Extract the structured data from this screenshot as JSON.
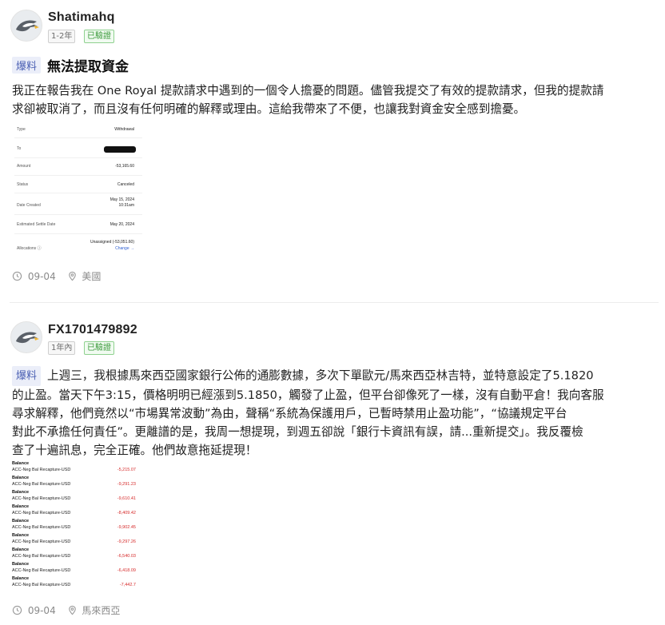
{
  "posts": [
    {
      "username": "Shatimahq",
      "tag_year": "1-2年",
      "tag_verified": "已驗證",
      "badge": "爆料",
      "title": "無法提取資金",
      "body_line1": "我正在報告我在 One Royal 提款請求中遇到的一個令人擔憂的問題。儘管我提交了有效的提款請求，但我的提款請",
      "body_line2": "求卻被取消了，而且沒有任何明確的解釋或理由。這給我帶來了不便，也讓我對資金安全感到擔憂。",
      "date": "09-04",
      "location": "美國",
      "screenshot": {
        "rows": [
          {
            "key": "Type",
            "value": "Withdrawal"
          },
          {
            "key": "To",
            "value": ""
          },
          {
            "key": "Amount",
            "value": "-53,165.60"
          },
          {
            "key": "Status",
            "value": "Canceled"
          },
          {
            "key": "Date Created",
            "value": "May 15, 2024",
            "value2": "10:31am"
          },
          {
            "key": "Estimated Settle Date",
            "value": "May 20, 2024"
          },
          {
            "key": "Allocations ⓘ",
            "value": "Unassigned (-53,051.60)",
            "value2": "Change →"
          }
        ]
      }
    },
    {
      "username": "FX1701479892",
      "tag_year": "1年內",
      "tag_verified": "已驗證",
      "badge": "爆料",
      "body_line1": "上週三，我根據馬來西亞國家銀行公佈的通膨數據，多次下單歐元/馬來西亞林吉特，並特意設定了5.1820",
      "body_line2": "的止盈。當天下午3:15，價格明明已經漲到5.1850，觸發了止盈，但平台卻像死了一樣，沒有自動平倉！我向客服",
      "body_line3": "尋求解釋，他們竟然以“市場異常波動”為由，聲稱“系統為保護用戶，已暫時禁用止盈功能”，“協議規定平台",
      "body_line4": "對此不承擔任何責任”。更離譜的是，我周一想提現，到週五卻說「銀行卡資訊有誤，請...重新提交」。我反覆檢",
      "body_line5": "查了十遍訊息，完全正確。他們故意拖延提現！",
      "date": "09-04",
      "location": "馬來西亞",
      "screenshot": {
        "entries": [
          {
            "label": "Balance",
            "desc": "ACC-Neg Bal Recapture-USD",
            "amount": "-5,215.07"
          },
          {
            "label": "Balance",
            "desc": "ACC-Neg Bal Recapture-USD",
            "amount": "-9,291.23"
          },
          {
            "label": "Balance",
            "desc": "ACC-Neg Bal Recapture-USD",
            "amount": "-9,610.41"
          },
          {
            "label": "Balance",
            "desc": "ACC-Neg Bal Recapture-USD",
            "amount": "-8,409.42"
          },
          {
            "label": "Balance",
            "desc": "ACC-Neg Bal Recapture-USD",
            "amount": "-9,902.45"
          },
          {
            "label": "Balance",
            "desc": "ACC-Neg Bal Recapture-USD",
            "amount": "-9,297.26"
          },
          {
            "label": "Balance",
            "desc": "ACC-Neg Bal Recapture-USD",
            "amount": "-6,540.03"
          },
          {
            "label": "Balance",
            "desc": "ACC-Neg Bal Recapture-USD",
            "amount": "-6,418.09"
          },
          {
            "label": "Balance",
            "desc": "ACC-Neg Bal Recapture-USD",
            "amount": "-7,442.7"
          }
        ]
      }
    }
  ]
}
